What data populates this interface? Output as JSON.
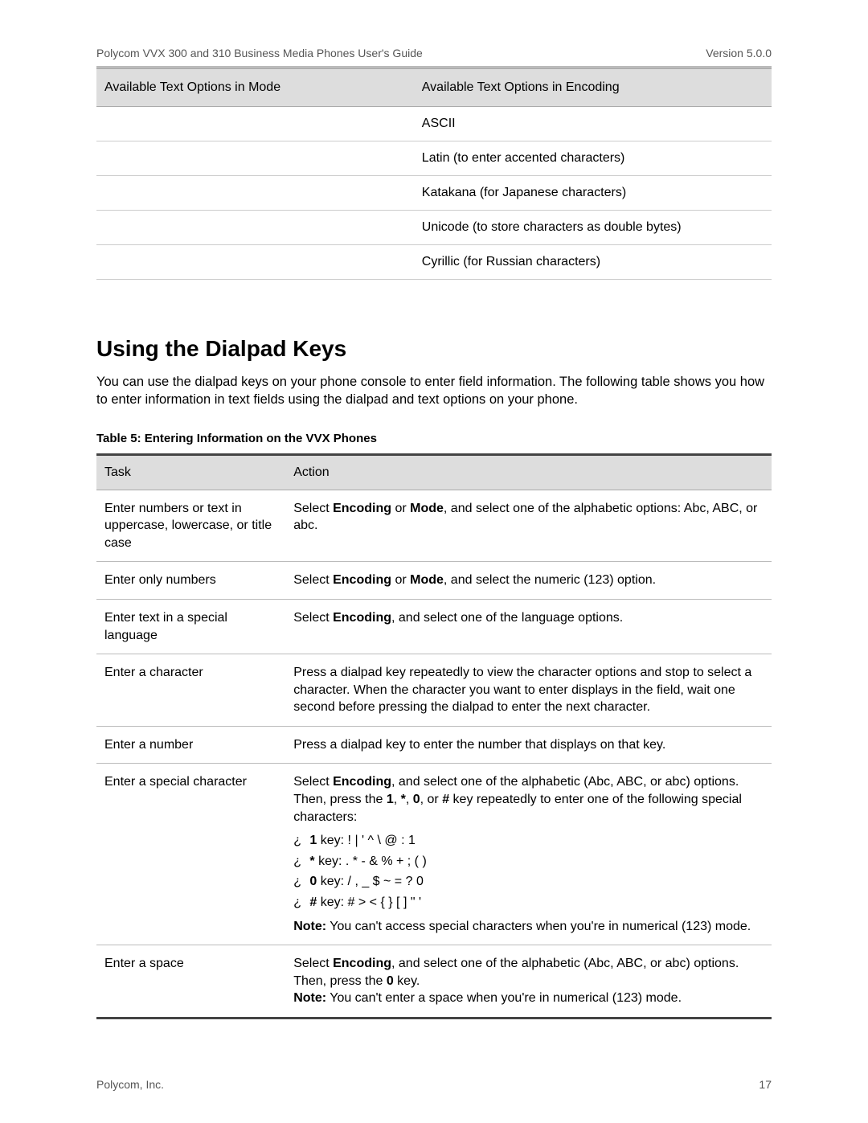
{
  "header": {
    "title": "Polycom VVX 300 and 310 Business Media Phones User's Guide",
    "version": "Version 5.0.0"
  },
  "optionsTable": {
    "headers": {
      "mode": "Available Text Options in Mode",
      "encoding": "Available Text Options in Encoding"
    },
    "rows": [
      {
        "mode": "",
        "encoding": "ASCII"
      },
      {
        "mode": "",
        "encoding": "Latin (to enter accented characters)"
      },
      {
        "mode": "",
        "encoding": "Katakana (for Japanese characters)"
      },
      {
        "mode": "",
        "encoding": "Unicode (to store characters as double bytes)"
      },
      {
        "mode": "",
        "encoding": "Cyrillic (for Russian characters)"
      }
    ]
  },
  "section": {
    "heading": "Using the Dialpad Keys",
    "intro": "You can use the dialpad keys on your phone console to enter field information. The following table shows you how to enter information in text fields using the dialpad and text options on your phone.",
    "tableCaption": "Table 5: Entering Information on the VVX Phones"
  },
  "taskTable": {
    "headers": {
      "task": "Task",
      "action": "Action"
    },
    "words": {
      "select": "Select ",
      "encoding": "Encoding",
      "mode": "Mode",
      "or": " or ",
      "note": "Note:",
      "key_1": "1",
      "key_star": "*",
      "key_0": "0",
      "key_hash": "#"
    },
    "rows": {
      "r1": {
        "task": "Enter numbers or text in uppercase, lowercase, or title case",
        "action_tail": ", and select one of the alphabetic options: Abc, ABC, or abc."
      },
      "r2": {
        "task": "Enter only numbers",
        "action_tail": ", and select the numeric (123) option."
      },
      "r3": {
        "task": "Enter text in a special language",
        "action_tail": ", and select one of the language options."
      },
      "r4": {
        "task": "Enter a character",
        "action": "Press a dialpad key repeatedly to view the character options and stop to select a character. When the character you want to enter displays in the field, wait one second before pressing the dialpad to enter the next character."
      },
      "r5": {
        "task": "Enter a number",
        "action": "Press a dialpad key to enter the number that displays on that key."
      },
      "r6": {
        "task": "Enter a special character",
        "intro_tail1": ", and select one of the alphabetic (Abc, ABC, or abc) options. Then, press the ",
        "intro_tail2": " key repeatedly to enter one of the following special characters:",
        "comma": ", ",
        "or_word": ", or ",
        "keys": {
          "k1": " key:  !  |  '  ^  \\  @  :  1",
          "kstar": " key:  .  *  -  &  %  +  ;  (  )",
          "k0": " key:  /  ,  _  $  ~  =  ?  0",
          "khash": " key:  #  >  <  {  }  [  ] \" '"
        },
        "note_text": " You can't access special characters when you're in numerical (123) mode."
      },
      "r7": {
        "task": "Enter a space",
        "action_tail1": ", and select one of the alphabetic (Abc, ABC, or abc) options. Then, press the ",
        "action_tail2": " key.",
        "note_text": " You can't enter a space when you're in numerical (123) mode."
      }
    }
  },
  "footer": {
    "company": "Polycom, Inc.",
    "page": "17"
  }
}
